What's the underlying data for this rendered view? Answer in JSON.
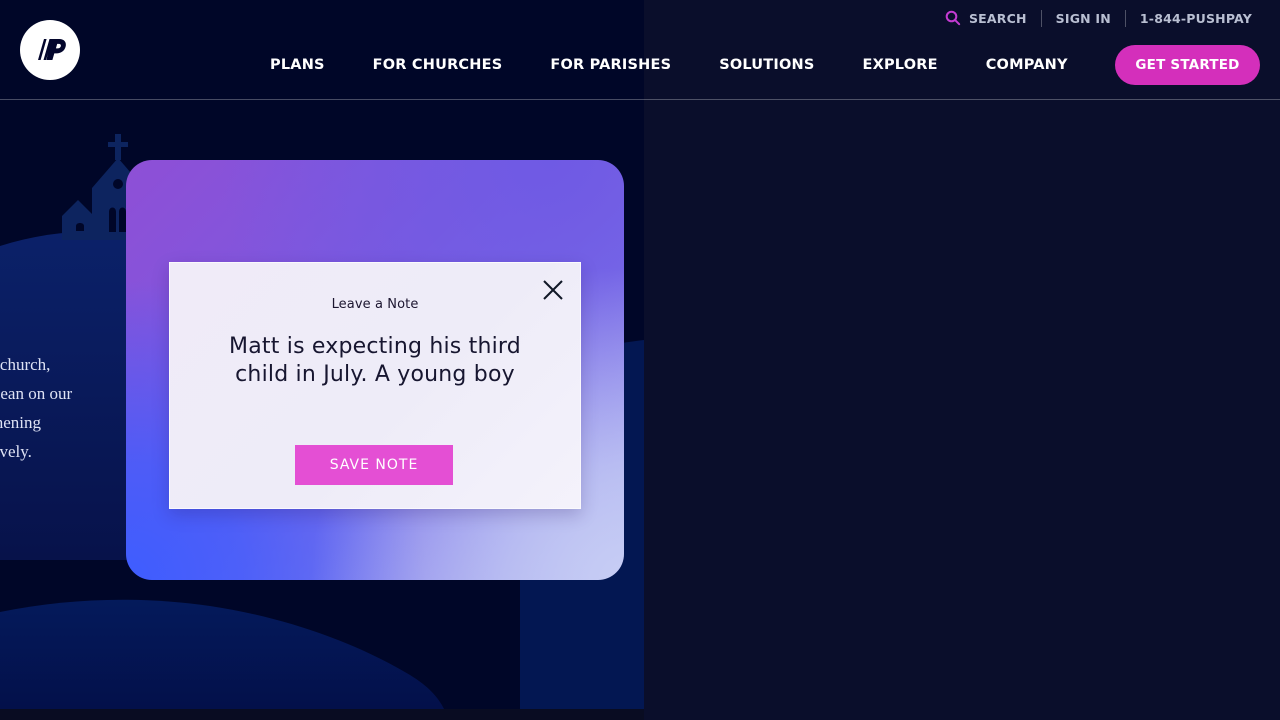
{
  "header": {
    "utility": {
      "search_label": "SEARCH",
      "sign_in_label": "SIGN IN",
      "phone_label": "1-844-PUSHPAY"
    },
    "main_nav": [
      {
        "label": "PLANS"
      },
      {
        "label": "FOR CHURCHES"
      },
      {
        "label": "FOR PARISHES"
      },
      {
        "label": "SOLUTIONS"
      },
      {
        "label": "EXPLORE"
      },
      {
        "label": "COMPANY"
      }
    ],
    "cta_label": "GET STARTED"
  },
  "hero": {
    "copy_lines": [
      "r church,",
      "Lean on our",
      "thening",
      "tively."
    ]
  },
  "modal": {
    "title": "Leave a Note",
    "note_text": "Matt is expecting his third child in July. A young boy",
    "save_label": "SAVE NOTE"
  },
  "colors": {
    "page_background": "#0a0e2b",
    "hero_background": "#000628",
    "accent_magenta": "#d42fbb",
    "modal_button": "#e44fd4",
    "modal_background": "#f0ebf8"
  },
  "icons": {
    "logo": "pushpay-logo",
    "search": "search-icon",
    "close": "close-icon",
    "church": "church-illustration"
  }
}
